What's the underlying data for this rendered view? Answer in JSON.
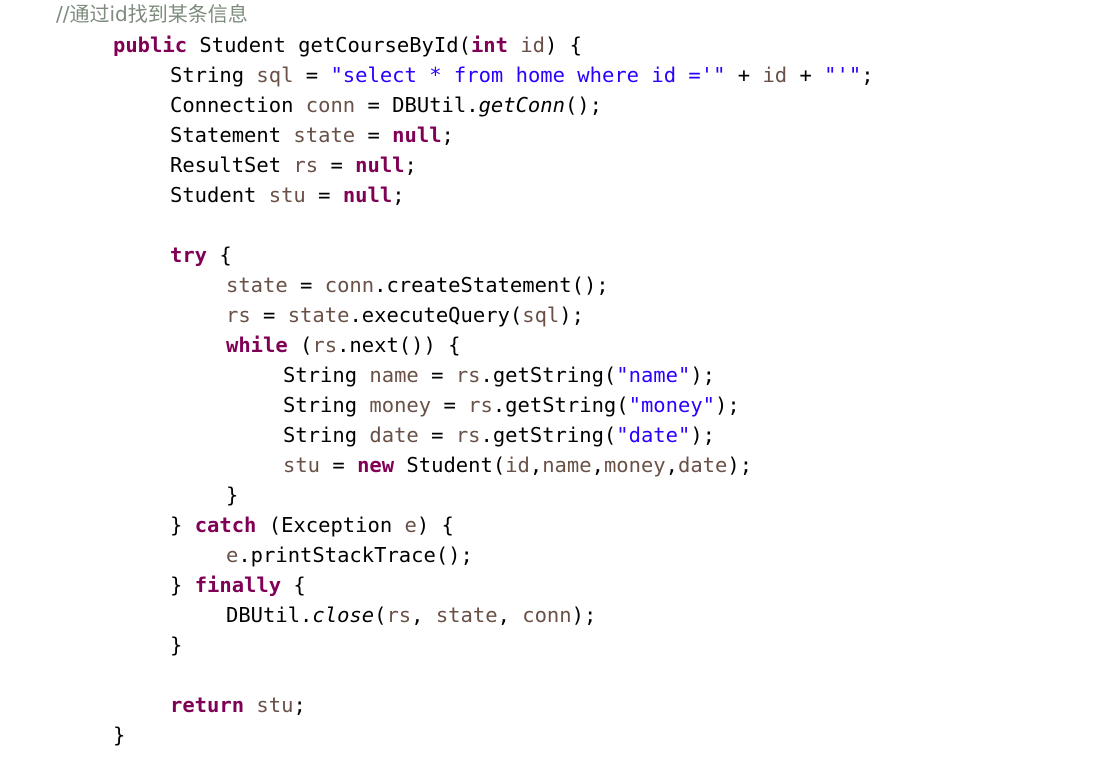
{
  "document": {
    "kind": "java-source-code-snippet",
    "language": "Java",
    "colors": {
      "background": "#ffffff",
      "default_text": "#000000",
      "keyword": "#7F0055",
      "string": "#2A00FF",
      "comment": "#7E8C7E",
      "local_variable": "#6A5147"
    },
    "full_text": "//通过id找到某条信息\n    public Student getCourseById(int id) {\n        String sql = \"select * from home where id ='\" + id + \"'\";\n        Connection conn = DBUtil.getConn();\n        Statement state = null;\n        ResultSet rs = null;\n        Student stu = null;\n\n        try {\n            state = conn.createStatement();\n            rs = state.executeQuery(sql);\n            while (rs.next()) {\n                String name = rs.getString(\"name\");\n                String money = rs.getString(\"money\");\n                String date = rs.getString(\"date\");\n                stu = new Student(id,name,money,date);\n            }\n        } catch (Exception e) {\n            e.printStackTrace();\n        } finally {\n            DBUtil.close(rs, state, conn);\n        }\n\n        return stu;\n    }",
    "lines": [
      {
        "n": 1,
        "indent": "i0",
        "tokens": [
          {
            "t": "//通过id找到某条信息",
            "c": "cmt"
          }
        ]
      },
      {
        "n": 2,
        "indent": "i1",
        "tokens": [
          {
            "t": "public",
            "c": "kw"
          },
          {
            "t": " Student getCourseById(",
            "c": "plain"
          },
          {
            "t": "int",
            "c": "kw"
          },
          {
            "t": " ",
            "c": "plain"
          },
          {
            "t": "id",
            "c": "var"
          },
          {
            "t": ") {",
            "c": "plain"
          }
        ]
      },
      {
        "n": 3,
        "indent": "i2",
        "tokens": [
          {
            "t": "String ",
            "c": "plain"
          },
          {
            "t": "sql",
            "c": "var"
          },
          {
            "t": " = ",
            "c": "plain"
          },
          {
            "t": "\"select * from home where id ='\"",
            "c": "str"
          },
          {
            "t": " + ",
            "c": "plain"
          },
          {
            "t": "id",
            "c": "var"
          },
          {
            "t": " + ",
            "c": "plain"
          },
          {
            "t": "\"'\"",
            "c": "str"
          },
          {
            "t": ";",
            "c": "plain"
          }
        ]
      },
      {
        "n": 4,
        "indent": "i2",
        "tokens": [
          {
            "t": "Connection ",
            "c": "plain"
          },
          {
            "t": "conn",
            "c": "var"
          },
          {
            "t": " = DBUtil.",
            "c": "plain"
          },
          {
            "t": "getConn",
            "c": "static"
          },
          {
            "t": "();",
            "c": "plain"
          }
        ]
      },
      {
        "n": 5,
        "indent": "i2",
        "tokens": [
          {
            "t": "Statement ",
            "c": "plain"
          },
          {
            "t": "state",
            "c": "var"
          },
          {
            "t": " = ",
            "c": "plain"
          },
          {
            "t": "null",
            "c": "kw"
          },
          {
            "t": ";",
            "c": "plain"
          }
        ]
      },
      {
        "n": 6,
        "indent": "i2",
        "tokens": [
          {
            "t": "ResultSet ",
            "c": "plain"
          },
          {
            "t": "rs",
            "c": "var"
          },
          {
            "t": " = ",
            "c": "plain"
          },
          {
            "t": "null",
            "c": "kw"
          },
          {
            "t": ";",
            "c": "plain"
          }
        ]
      },
      {
        "n": 7,
        "indent": "i2",
        "tokens": [
          {
            "t": "Student ",
            "c": "plain"
          },
          {
            "t": "stu",
            "c": "var"
          },
          {
            "t": " = ",
            "c": "plain"
          },
          {
            "t": "null",
            "c": "kw"
          },
          {
            "t": ";",
            "c": "plain"
          }
        ]
      },
      {
        "n": 8,
        "indent": "i2",
        "tokens": [
          {
            "t": " ",
            "c": "blank"
          }
        ]
      },
      {
        "n": 9,
        "indent": "i2",
        "tokens": [
          {
            "t": "try",
            "c": "kw"
          },
          {
            "t": " {",
            "c": "plain"
          }
        ]
      },
      {
        "n": 10,
        "indent": "i3",
        "tokens": [
          {
            "t": "state",
            "c": "var"
          },
          {
            "t": " = ",
            "c": "plain"
          },
          {
            "t": "conn",
            "c": "var"
          },
          {
            "t": ".createStatement();",
            "c": "plain"
          }
        ]
      },
      {
        "n": 11,
        "indent": "i3",
        "tokens": [
          {
            "t": "rs",
            "c": "var"
          },
          {
            "t": " = ",
            "c": "plain"
          },
          {
            "t": "state",
            "c": "var"
          },
          {
            "t": ".executeQuery(",
            "c": "plain"
          },
          {
            "t": "sql",
            "c": "var"
          },
          {
            "t": ");",
            "c": "plain"
          }
        ]
      },
      {
        "n": 12,
        "indent": "i3",
        "tokens": [
          {
            "t": "while",
            "c": "kw"
          },
          {
            "t": " (",
            "c": "plain"
          },
          {
            "t": "rs",
            "c": "var"
          },
          {
            "t": ".next()) {",
            "c": "plain"
          }
        ]
      },
      {
        "n": 13,
        "indent": "i4",
        "tokens": [
          {
            "t": "String ",
            "c": "plain"
          },
          {
            "t": "name",
            "c": "var"
          },
          {
            "t": " = ",
            "c": "plain"
          },
          {
            "t": "rs",
            "c": "var"
          },
          {
            "t": ".getString(",
            "c": "plain"
          },
          {
            "t": "\"name\"",
            "c": "str"
          },
          {
            "t": ");",
            "c": "plain"
          }
        ]
      },
      {
        "n": 14,
        "indent": "i4",
        "tokens": [
          {
            "t": "String ",
            "c": "plain"
          },
          {
            "t": "money",
            "c": "var"
          },
          {
            "t": " = ",
            "c": "plain"
          },
          {
            "t": "rs",
            "c": "var"
          },
          {
            "t": ".getString(",
            "c": "plain"
          },
          {
            "t": "\"money\"",
            "c": "str"
          },
          {
            "t": ");",
            "c": "plain"
          }
        ]
      },
      {
        "n": 15,
        "indent": "i4",
        "tokens": [
          {
            "t": "String ",
            "c": "plain"
          },
          {
            "t": "date",
            "c": "var"
          },
          {
            "t": " = ",
            "c": "plain"
          },
          {
            "t": "rs",
            "c": "var"
          },
          {
            "t": ".getString(",
            "c": "plain"
          },
          {
            "t": "\"date\"",
            "c": "str"
          },
          {
            "t": ");",
            "c": "plain"
          }
        ]
      },
      {
        "n": 16,
        "indent": "i4",
        "tokens": [
          {
            "t": "stu",
            "c": "var"
          },
          {
            "t": " = ",
            "c": "plain"
          },
          {
            "t": "new",
            "c": "kw"
          },
          {
            "t": " Student(",
            "c": "plain"
          },
          {
            "t": "id",
            "c": "var"
          },
          {
            "t": ",",
            "c": "plain"
          },
          {
            "t": "name",
            "c": "var"
          },
          {
            "t": ",",
            "c": "plain"
          },
          {
            "t": "money",
            "c": "var"
          },
          {
            "t": ",",
            "c": "plain"
          },
          {
            "t": "date",
            "c": "var"
          },
          {
            "t": ");",
            "c": "plain"
          }
        ]
      },
      {
        "n": 17,
        "indent": "i3",
        "tokens": [
          {
            "t": "}",
            "c": "plain"
          }
        ]
      },
      {
        "n": 18,
        "indent": "i2",
        "tokens": [
          {
            "t": "} ",
            "c": "plain"
          },
          {
            "t": "catch",
            "c": "kw"
          },
          {
            "t": " (Exception ",
            "c": "plain"
          },
          {
            "t": "e",
            "c": "var"
          },
          {
            "t": ") {",
            "c": "plain"
          }
        ]
      },
      {
        "n": 19,
        "indent": "i3",
        "tokens": [
          {
            "t": "e",
            "c": "var"
          },
          {
            "t": ".printStackTrace();",
            "c": "plain"
          }
        ]
      },
      {
        "n": 20,
        "indent": "i2",
        "tokens": [
          {
            "t": "} ",
            "c": "plain"
          },
          {
            "t": "finally",
            "c": "kw"
          },
          {
            "t": " {",
            "c": "plain"
          }
        ]
      },
      {
        "n": 21,
        "indent": "i3",
        "tokens": [
          {
            "t": "DBUtil.",
            "c": "plain"
          },
          {
            "t": "close",
            "c": "static"
          },
          {
            "t": "(",
            "c": "plain"
          },
          {
            "t": "rs",
            "c": "var"
          },
          {
            "t": ", ",
            "c": "plain"
          },
          {
            "t": "state",
            "c": "var"
          },
          {
            "t": ", ",
            "c": "plain"
          },
          {
            "t": "conn",
            "c": "var"
          },
          {
            "t": ");",
            "c": "plain"
          }
        ]
      },
      {
        "n": 22,
        "indent": "i2",
        "tokens": [
          {
            "t": "}",
            "c": "plain"
          }
        ]
      },
      {
        "n": 23,
        "indent": "i2",
        "tokens": [
          {
            "t": " ",
            "c": "blank"
          }
        ]
      },
      {
        "n": 24,
        "indent": "i2",
        "tokens": [
          {
            "t": "return",
            "c": "kw"
          },
          {
            "t": " ",
            "c": "plain"
          },
          {
            "t": "stu",
            "c": "var"
          },
          {
            "t": ";",
            "c": "plain"
          }
        ]
      },
      {
        "n": 25,
        "indent": "i1",
        "tokens": [
          {
            "t": "}",
            "c": "plain"
          }
        ]
      }
    ]
  }
}
